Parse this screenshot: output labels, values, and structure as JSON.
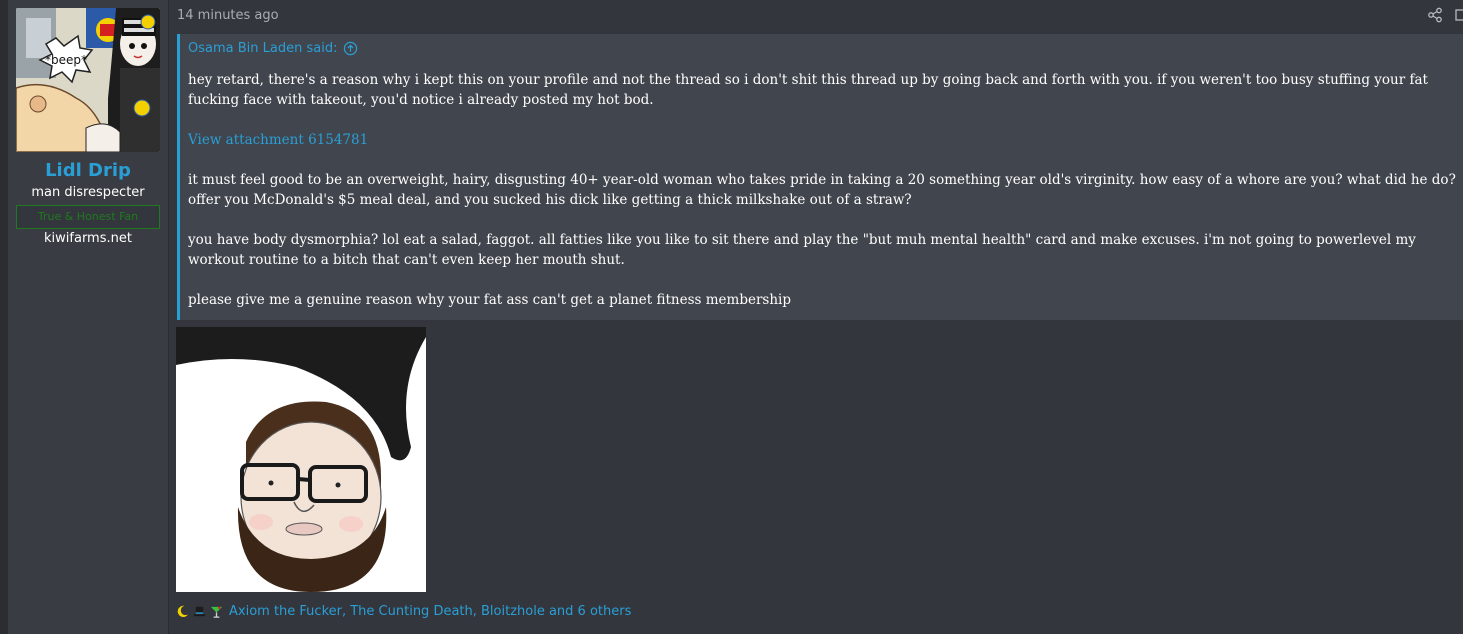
{
  "user": {
    "name": "Lidl Drip",
    "title": "man disrespecter",
    "badge": "True & Honest Fan",
    "site": "kiwifarms.net",
    "avatar_caption": "*beep*"
  },
  "post": {
    "time": "14 minutes ago",
    "quote": {
      "author": "Osama Bin Laden said:",
      "paragraphs": [
        "hey retard, there's a reason why i kept this on your profile and not the thread so i don't shit this thread up by going back and forth with you. if you weren't too busy stuffing your fat fucking face with takeout, you'd notice i already posted my hot bod.",
        "it must feel good to be an overweight, hairy, disgusting 40+ year-old woman who takes pride in taking a 20 something year old's virginity. how easy of a whore are you? what did he do? offer you McDonald's $5 meal deal, and you sucked his dick like getting a thick milkshake out of a straw?",
        "you have body dysmorphia? lol eat a salad, faggot. all fatties like you like to sit there and play the \"but muh mental health\" card and make excuses. i'm not going to powerlevel my workout routine to a bitch that can't even keep her mouth shut.",
        "please give me a genuine reason why your fat ass can't get a planet fitness membership"
      ],
      "attachment_label": "View attachment 6154781"
    },
    "reactions": {
      "icons": [
        "moon-icon",
        "tophat-icon",
        "cocktail-icon"
      ],
      "text": "Axiom the Fucker, The Cunting Death, Bloitzhole and 6 others"
    }
  },
  "colors": {
    "accent": "#2a9fd6",
    "background": "#33363c",
    "quote_bg": "#41454d",
    "badge": "#1f7a1f"
  }
}
